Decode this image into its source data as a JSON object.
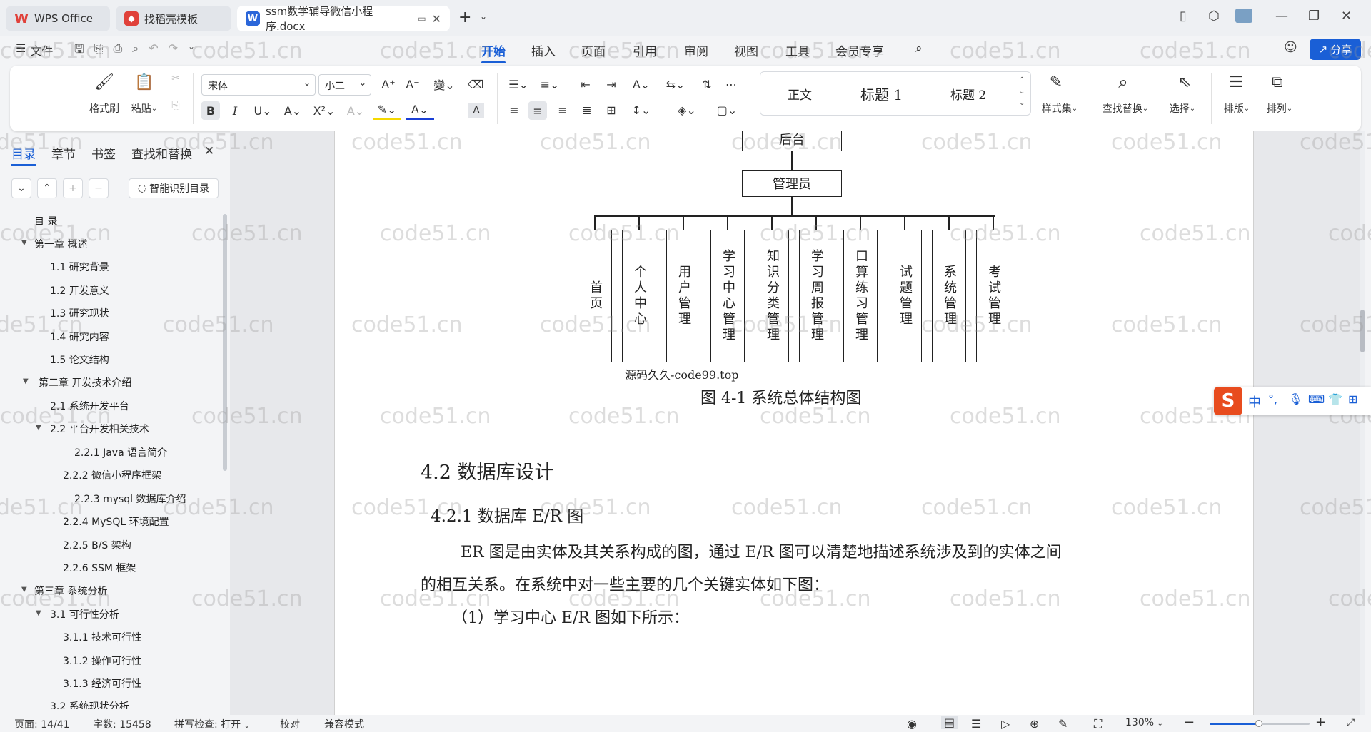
{
  "titlebar": {
    "tabs": [
      {
        "label": "WPS Office"
      },
      {
        "label": "找稻壳模板"
      },
      {
        "label": "ssm数学辅导微信小程序.docx"
      }
    ],
    "new_tab": "+"
  },
  "menubar": {
    "file": "文件",
    "items": [
      "开始",
      "插入",
      "页面",
      "引用",
      "审阅",
      "视图",
      "工具",
      "会员专享"
    ],
    "share": "分享"
  },
  "ribbon": {
    "format_painter": "格式刷",
    "paste": "粘贴",
    "font_name": "宋体",
    "font_size": "小二",
    "styles": [
      "正文",
      "标题 1",
      "标题 2"
    ],
    "style_set": "样式集",
    "find_replace": "查找替换",
    "select": "选择",
    "layout": "排版",
    "arrange": "排列"
  },
  "leftpane": {
    "tabs": [
      "目录",
      "章节",
      "书签",
      "查找和替换"
    ],
    "smart_toc": "智能识别目录",
    "toc": [
      {
        "label": "目  录"
      },
      {
        "label": "第一章  概述"
      },
      {
        "label": "1.1  研究背景"
      },
      {
        "label": "1.2  开发意义"
      },
      {
        "label": "1.3  研究现状"
      },
      {
        "label": "1.4  研究内容"
      },
      {
        "label": "1.5  论文结构"
      },
      {
        "label": "第二章  开发技术介绍"
      },
      {
        "label": "2.1  系统开发平台"
      },
      {
        "label": "2.2  平台开发相关技术"
      },
      {
        "label": "2.2.1    Java 语言简介"
      },
      {
        "label": "2.2.2    微信小程序框架"
      },
      {
        "label": "2.2.3    mysql 数据库介绍"
      },
      {
        "label": "2.2.4    MySQL 环境配置"
      },
      {
        "label": "2.2.5    B/S 架构"
      },
      {
        "label": "2.2.6    SSM 框架"
      },
      {
        "label": "第三章  系统分析"
      },
      {
        "label": "3.1  可行性分析"
      },
      {
        "label": "3.1.1  技术可行性"
      },
      {
        "label": "3.1.2  操作可行性"
      },
      {
        "label": "3.1.3  经济可行性"
      },
      {
        "label": "3.2  系统现状分析"
      }
    ]
  },
  "document": {
    "diagram": {
      "top": "后台",
      "admin": "管理员",
      "modules": [
        "首页",
        "个人中心",
        "用户管理",
        "学习中心管理",
        "知识分类管理",
        "学习周报管理",
        "口算练习管理",
        "试题管理",
        "系统管理",
        "考试管理"
      ]
    },
    "source_note": "源码久久-code99.top",
    "caption": "图 4-1  系统总体结构图",
    "h2": "4.2  数据库设计",
    "h3": "4.2.1  数据库 E/R 图",
    "para1": "ER 图是由实体及其关系构成的图，通过 E/R 图可以清楚地描述系统涉及到的实体之间",
    "para2": "的相互关系。在系统中对一些主要的几个关键实体如下图：",
    "para3": "（1）学习中心 E/R 图如下所示：",
    "watermark": "code51.cn"
  },
  "ime": {
    "label": "中"
  },
  "status": {
    "page": "页面: 14/41",
    "words": "字数: 15458",
    "spell": "拼写检查: 打开",
    "proof": "校对",
    "compat": "兼容模式",
    "zoom": "130%"
  },
  "colors": {
    "accent": "#1a5fd6",
    "wps_red": "#e0413a"
  }
}
